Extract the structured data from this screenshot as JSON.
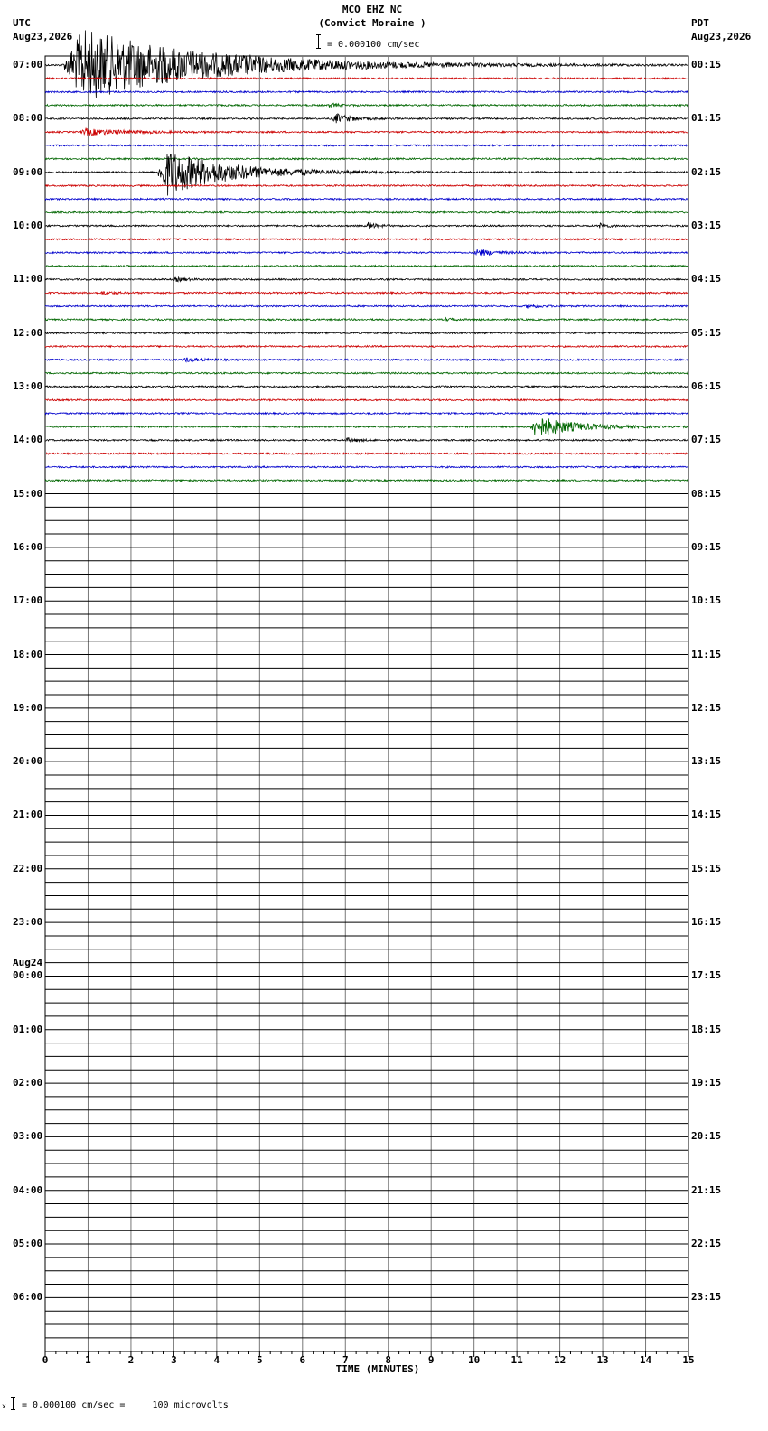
{
  "header": {
    "station": "MCO EHZ NC",
    "location": "(Convict Moraine )",
    "scale_text": "= 0.000100 cm/sec",
    "left_zone": "UTC",
    "left_date": "Aug23,2026",
    "right_zone": "PDT",
    "right_date": "Aug23,2026"
  },
  "footer": {
    "scale_note": "= 0.000100 cm/sec =     100 microvolts",
    "scale_marker": "x"
  },
  "chart_data": {
    "type": "line",
    "title": "MCO EHZ NC (Convict Moraine )",
    "xlabel": "TIME (MINUTES)",
    "x_ticks": [
      "0",
      "1",
      "2",
      "3",
      "4",
      "5",
      "6",
      "7",
      "8",
      "9",
      "10",
      "11",
      "12",
      "13",
      "14",
      "15"
    ],
    "xlim": [
      0,
      15
    ],
    "rows_per_hour": 4,
    "minutes_per_row": 15,
    "total_rows": 96,
    "left_labels": [
      "07:00",
      "08:00",
      "09:00",
      "10:00",
      "11:00",
      "12:00",
      "13:00",
      "14:00",
      "15:00",
      "16:00",
      "17:00",
      "18:00",
      "19:00",
      "20:00",
      "21:00",
      "22:00",
      "23:00",
      "00:00",
      "01:00",
      "02:00",
      "03:00",
      "04:00",
      "05:00",
      "06:00"
    ],
    "date_change_label": "Aug24",
    "date_change_index": 17,
    "right_labels": [
      "00:15",
      "01:15",
      "02:15",
      "03:15",
      "04:15",
      "05:15",
      "06:15",
      "07:15",
      "08:15",
      "09:15",
      "10:15",
      "11:15",
      "12:15",
      "13:15",
      "14:15",
      "15:15",
      "16:15",
      "17:15",
      "18:15",
      "19:15",
      "20:15",
      "21:15",
      "22:15",
      "23:15"
    ],
    "trace_colors": [
      "#000000",
      "#cc0000",
      "#0000cc",
      "#006600"
    ],
    "grid_color": "#777777",
    "traced_rows": 32,
    "events": [
      {
        "row": 0,
        "start_min": 4.6,
        "duration_min": 0.4,
        "amp": 0.4
      },
      {
        "row": 0,
        "start_min": 0.4,
        "duration_min": 6.0,
        "amp": 6.0
      },
      {
        "row": 3,
        "start_min": 6.6,
        "duration_min": 0.5,
        "amp": 0.3
      },
      {
        "row": 4,
        "start_min": 6.7,
        "duration_min": 0.8,
        "amp": 0.8
      },
      {
        "row": 5,
        "start_min": 0.8,
        "duration_min": 2.0,
        "amp": 0.5
      },
      {
        "row": 8,
        "start_min": 2.6,
        "duration_min": 3.0,
        "amp": 3.8
      },
      {
        "row": 12,
        "start_min": 7.5,
        "duration_min": 0.4,
        "amp": 0.6
      },
      {
        "row": 12,
        "start_min": 12.9,
        "duration_min": 0.4,
        "amp": 0.4
      },
      {
        "row": 14,
        "start_min": 10.0,
        "duration_min": 0.9,
        "amp": 0.6
      },
      {
        "row": 16,
        "start_min": 3.0,
        "duration_min": 0.6,
        "amp": 0.3
      },
      {
        "row": 17,
        "start_min": 1.3,
        "duration_min": 0.5,
        "amp": 0.3
      },
      {
        "row": 18,
        "start_min": 11.2,
        "duration_min": 0.6,
        "amp": 0.3
      },
      {
        "row": 19,
        "start_min": 9.3,
        "duration_min": 0.5,
        "amp": 0.2
      },
      {
        "row": 22,
        "start_min": 3.2,
        "duration_min": 0.8,
        "amp": 0.3
      },
      {
        "row": 27,
        "start_min": 11.3,
        "duration_min": 1.8,
        "amp": 1.8
      },
      {
        "row": 28,
        "start_min": 7.0,
        "duration_min": 0.6,
        "amp": 0.3
      }
    ]
  }
}
